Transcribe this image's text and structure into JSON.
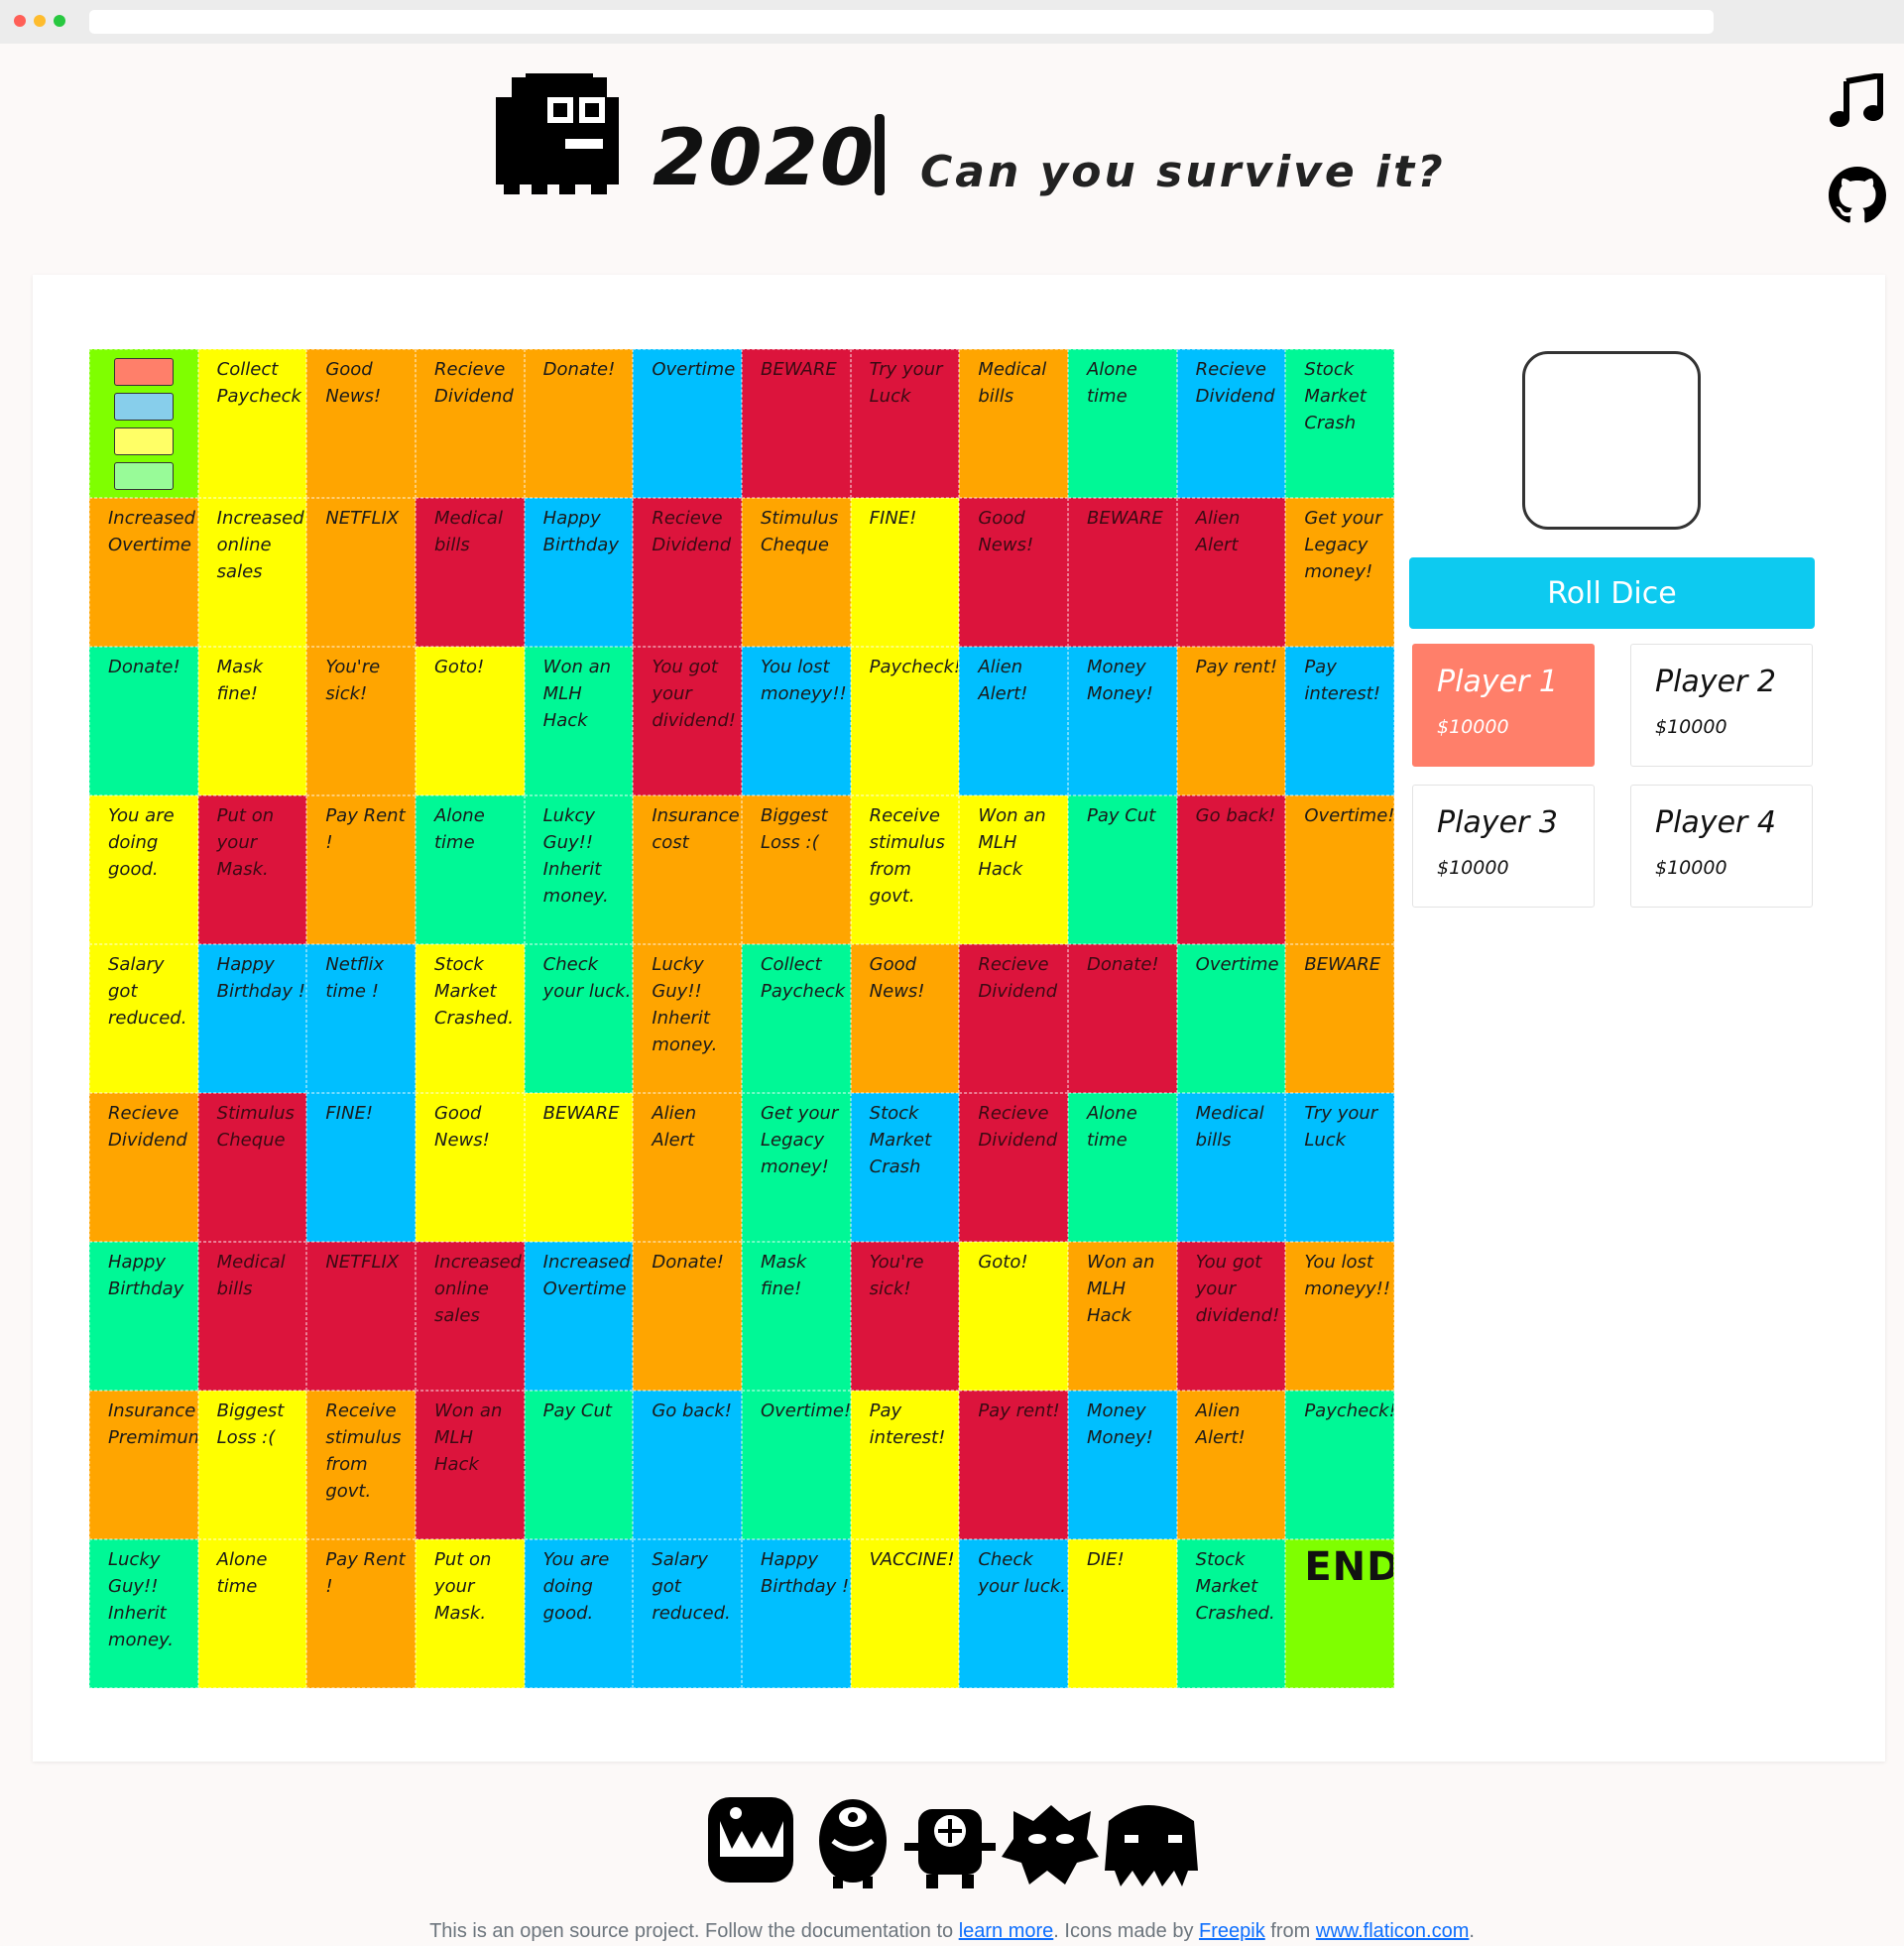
{
  "app": {
    "title_main": "2020",
    "title_sub": "Can you survive it?"
  },
  "colors": {
    "green": "#00f896",
    "yellow": "#ffff00",
    "orange": "#ffa500",
    "blue": "#00bfff",
    "red": "#dc143c",
    "lime": "#7fff00",
    "token_colors": [
      "#ff7f6a",
      "#87ceeb",
      "#ffff66",
      "#98fb98"
    ]
  },
  "icons": {
    "logo": "pixel-monster-icon",
    "music": "music-note-icon",
    "github": "github-icon",
    "footer_monsters": [
      "monster-1-icon",
      "monster-2-icon",
      "monster-3-icon",
      "monster-4-icon",
      "monster-5-icon"
    ]
  },
  "board": {
    "rows": [
      [
        {
          "c": "lime",
          "t": ""
        },
        {
          "c": "yellow",
          "t": "Collect Paycheck"
        },
        {
          "c": "orange",
          "t": "Good News!"
        },
        {
          "c": "orange",
          "t": "Recieve Dividend"
        },
        {
          "c": "orange",
          "t": "Donate!"
        },
        {
          "c": "blue",
          "t": "Overtime"
        },
        {
          "c": "red",
          "t": "BEWARE"
        },
        {
          "c": "red",
          "t": "Try your Luck"
        },
        {
          "c": "orange",
          "t": "Medical bills"
        },
        {
          "c": "green",
          "t": "Alone time"
        },
        {
          "c": "blue",
          "t": "Recieve Dividend"
        },
        {
          "c": "green",
          "t": "Stock Market Crash"
        }
      ],
      [
        {
          "c": "orange",
          "t": "Increased Overtime"
        },
        {
          "c": "yellow",
          "t": "Increased online sales"
        },
        {
          "c": "orange",
          "t": "NETFLIX"
        },
        {
          "c": "red",
          "t": "Medical bills"
        },
        {
          "c": "blue",
          "t": "Happy Birthday"
        },
        {
          "c": "red",
          "t": "Recieve Dividend"
        },
        {
          "c": "orange",
          "t": "Stimulus Cheque"
        },
        {
          "c": "yellow",
          "t": "FINE!"
        },
        {
          "c": "red",
          "t": "Good News!"
        },
        {
          "c": "red",
          "t": "BEWARE"
        },
        {
          "c": "red",
          "t": "Alien Alert"
        },
        {
          "c": "orange",
          "t": "Get your Legacy money!"
        }
      ],
      [
        {
          "c": "green",
          "t": "Donate!"
        },
        {
          "c": "yellow",
          "t": "Mask fine!"
        },
        {
          "c": "orange",
          "t": "You're sick!"
        },
        {
          "c": "yellow",
          "t": "Goto!"
        },
        {
          "c": "green",
          "t": "Won an MLH Hack"
        },
        {
          "c": "red",
          "t": "You got your dividend!"
        },
        {
          "c": "blue",
          "t": "You lost moneyy!!"
        },
        {
          "c": "yellow",
          "t": "Paycheck!"
        },
        {
          "c": "blue",
          "t": "Alien Alert!"
        },
        {
          "c": "blue",
          "t": "Money Money!"
        },
        {
          "c": "orange",
          "t": "Pay rent!"
        },
        {
          "c": "blue",
          "t": "Pay interest!"
        }
      ],
      [
        {
          "c": "yellow",
          "t": "You are doing good."
        },
        {
          "c": "red",
          "t": "Put on your Mask."
        },
        {
          "c": "orange",
          "t": "Pay Rent !"
        },
        {
          "c": "green",
          "t": "Alone time"
        },
        {
          "c": "green",
          "t": "Lukcy Guy!! Inherit money."
        },
        {
          "c": "orange",
          "t": "Insurance cost"
        },
        {
          "c": "orange",
          "t": "Biggest Loss :("
        },
        {
          "c": "yellow",
          "t": "Receive stimulus from govt."
        },
        {
          "c": "yellow",
          "t": "Won an MLH Hack"
        },
        {
          "c": "green",
          "t": "Pay Cut"
        },
        {
          "c": "red",
          "t": "Go back!"
        },
        {
          "c": "orange",
          "t": "Overtime!"
        }
      ],
      [
        {
          "c": "yellow",
          "t": "Salary got reduced."
        },
        {
          "c": "blue",
          "t": "Happy Birthday !"
        },
        {
          "c": "blue",
          "t": "Netflix time !"
        },
        {
          "c": "yellow",
          "t": "Stock Market Crashed."
        },
        {
          "c": "green",
          "t": "Check your luck."
        },
        {
          "c": "orange",
          "t": "Lucky Guy!! Inherit money."
        },
        {
          "c": "green",
          "t": "Collect Paycheck"
        },
        {
          "c": "orange",
          "t": "Good News!"
        },
        {
          "c": "red",
          "t": "Recieve Dividend"
        },
        {
          "c": "red",
          "t": "Donate!"
        },
        {
          "c": "green",
          "t": "Overtime"
        },
        {
          "c": "orange",
          "t": "BEWARE"
        }
      ],
      [
        {
          "c": "orange",
          "t": "Recieve Dividend"
        },
        {
          "c": "red",
          "t": "Stimulus Cheque"
        },
        {
          "c": "blue",
          "t": "FINE!"
        },
        {
          "c": "yellow",
          "t": "Good News!"
        },
        {
          "c": "yellow",
          "t": "BEWARE"
        },
        {
          "c": "orange",
          "t": "Alien Alert"
        },
        {
          "c": "green",
          "t": "Get your Legacy money!"
        },
        {
          "c": "blue",
          "t": "Stock Market Crash"
        },
        {
          "c": "red",
          "t": "Recieve Dividend"
        },
        {
          "c": "green",
          "t": "Alone time"
        },
        {
          "c": "blue",
          "t": "Medical bills"
        },
        {
          "c": "blue",
          "t": "Try your Luck"
        }
      ],
      [
        {
          "c": "green",
          "t": "Happy Birthday"
        },
        {
          "c": "red",
          "t": "Medical bills"
        },
        {
          "c": "red",
          "t": "NETFLIX"
        },
        {
          "c": "red",
          "t": "Increased online sales"
        },
        {
          "c": "blue",
          "t": "Increased Overtime"
        },
        {
          "c": "orange",
          "t": "Donate!"
        },
        {
          "c": "green",
          "t": "Mask fine!"
        },
        {
          "c": "red",
          "t": "You're sick!"
        },
        {
          "c": "yellow",
          "t": "Goto!"
        },
        {
          "c": "orange",
          "t": "Won an MLH Hack"
        },
        {
          "c": "red",
          "t": "You got your dividend!"
        },
        {
          "c": "orange",
          "t": "You lost moneyy!!"
        }
      ],
      [
        {
          "c": "orange",
          "t": "Insurance Premimum"
        },
        {
          "c": "yellow",
          "t": "Biggest Loss :("
        },
        {
          "c": "orange",
          "t": "Receive stimulus from govt."
        },
        {
          "c": "red",
          "t": "Won an MLH Hack"
        },
        {
          "c": "green",
          "t": "Pay Cut"
        },
        {
          "c": "blue",
          "t": "Go back!"
        },
        {
          "c": "green",
          "t": "Overtime!"
        },
        {
          "c": "yellow",
          "t": "Pay interest!"
        },
        {
          "c": "red",
          "t": "Pay rent!"
        },
        {
          "c": "blue",
          "t": "Money Money!"
        },
        {
          "c": "orange",
          "t": "Alien Alert!"
        },
        {
          "c": "green",
          "t": "Paycheck!"
        }
      ],
      [
        {
          "c": "green",
          "t": "Lucky Guy!! Inherit money."
        },
        {
          "c": "yellow",
          "t": "Alone time"
        },
        {
          "c": "orange",
          "t": "Pay Rent !"
        },
        {
          "c": "yellow",
          "t": "Put on your Mask."
        },
        {
          "c": "blue",
          "t": "You are doing good."
        },
        {
          "c": "blue",
          "t": "Salary got reduced."
        },
        {
          "c": "blue",
          "t": "Happy Birthday !"
        },
        {
          "c": "yellow",
          "t": "VACCINE!"
        },
        {
          "c": "blue",
          "t": "Check your luck."
        },
        {
          "c": "yellow",
          "t": "DIE!"
        },
        {
          "c": "green",
          "t": "Stock Market Crashed."
        },
        {
          "c": "lime",
          "t": "END"
        }
      ]
    ]
  },
  "controls": {
    "roll_label": "Roll Dice",
    "players": [
      {
        "name": "Player 1",
        "money": "$10000",
        "active": true
      },
      {
        "name": "Player 2",
        "money": "$10000",
        "active": false
      },
      {
        "name": "Player 3",
        "money": "$10000",
        "active": false
      },
      {
        "name": "Player 4",
        "money": "$10000",
        "active": false
      }
    ]
  },
  "footer": {
    "text_1": "This is an open source project. Follow the documentation to ",
    "link_1": "learn more",
    "text_2": ". Icons made by ",
    "link_2": "Freepik",
    "text_3": " from ",
    "link_3": "www.flaticon.com",
    "text_4": "."
  }
}
